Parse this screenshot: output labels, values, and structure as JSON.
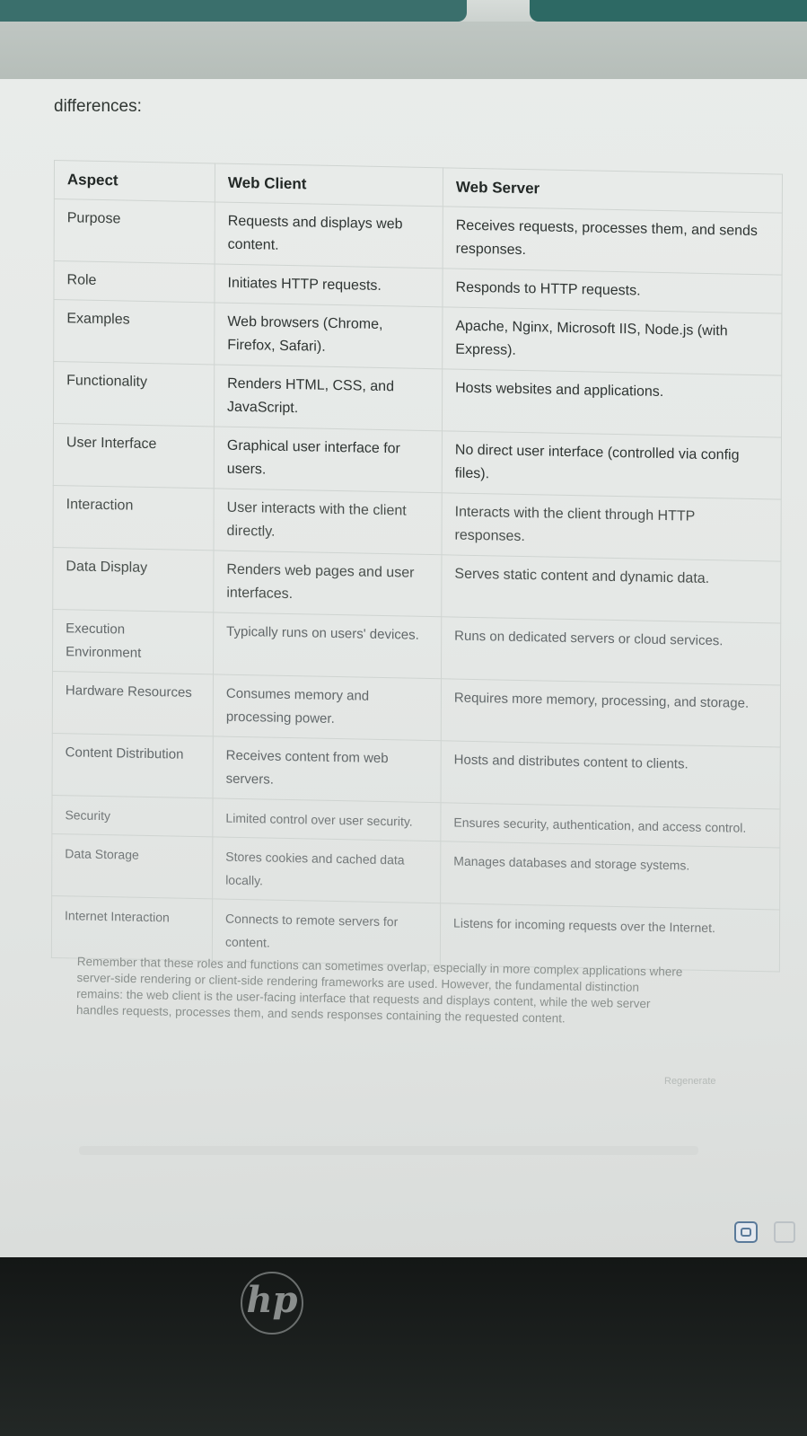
{
  "intro": "differences:",
  "table": {
    "headers": [
      "Aspect",
      "Web Client",
      "Web Server"
    ],
    "rows": [
      {
        "aspect": "Purpose",
        "client": "Requests and displays web content.",
        "server": "Receives requests, processes them, and sends responses."
      },
      {
        "aspect": "Role",
        "client": "Initiates HTTP requests.",
        "server": "Responds to HTTP requests."
      },
      {
        "aspect": "Examples",
        "client": "Web browsers (Chrome, Firefox, Safari).",
        "server": "Apache, Nginx, Microsoft IIS, Node.js (with Express)."
      },
      {
        "aspect": "Functionality",
        "client": "Renders HTML, CSS, and JavaScript.",
        "server": "Hosts websites and applications."
      },
      {
        "aspect": "User Interface",
        "client": "Graphical user interface for users.",
        "server": "No direct user interface (controlled via config files)."
      },
      {
        "aspect": "Interaction",
        "client": "User interacts with the client directly.",
        "server": "Interacts with the client through HTTP responses."
      },
      {
        "aspect": "Data Display",
        "client": "Renders web pages and user interfaces.",
        "server": "Serves static content and dynamic data."
      },
      {
        "aspect": "Execution Environment",
        "client": "Typically runs on users' devices.",
        "server": "Runs on dedicated servers or cloud services."
      },
      {
        "aspect": "Hardware Resources",
        "client": "Consumes memory and processing power.",
        "server": "Requires more memory, processing, and storage."
      },
      {
        "aspect": "Content Distribution",
        "client": "Receives content from web servers.",
        "server": "Hosts and distributes content to clients."
      },
      {
        "aspect": "Security",
        "client": "Limited control over user security.",
        "server": "Ensures security, authentication, and access control."
      },
      {
        "aspect": "Data Storage",
        "client": "Stores cookies and cached data locally.",
        "server": "Manages databases and storage systems."
      },
      {
        "aspect": "Internet Interaction",
        "client": "Connects to remote servers for content.",
        "server": "Listens for incoming requests over the Internet."
      }
    ]
  },
  "footer_text": "Remember that these roles and functions can sometimes overlap, especially in more complex applications where server-side rendering or client-side rendering frameworks are used. However, the fundamental distinction remains: the web client is the user-facing interface that requests and displays content, while the web server handles requests, processes them, and sends responses containing the requested content.",
  "regenerate_label": "Regenerate",
  "brand_logo": "hp",
  "icons": [
    "copy-icon",
    "hp-logo"
  ]
}
